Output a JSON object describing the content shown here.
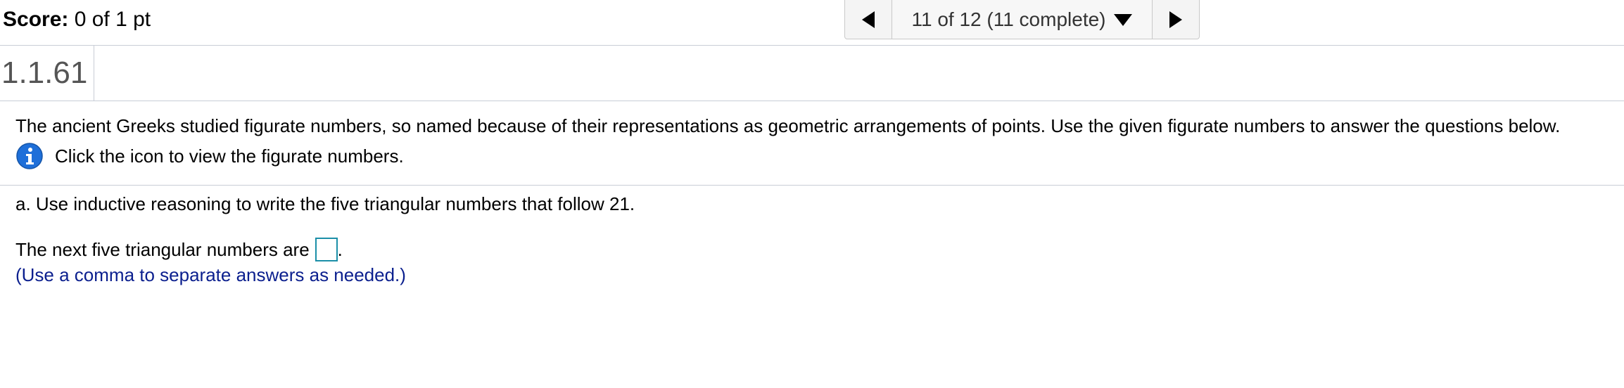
{
  "header": {
    "score_label": "Score:",
    "score_value": "0 of 1 pt",
    "nav": {
      "position_text": "11 of 12 (11 complete)"
    }
  },
  "question": {
    "id": "1.1.61",
    "intro": "The ancient Greeks studied figurate numbers, so named because of their representations as geometric arrangements of points.  Use the given figurate numbers to answer the questions below.",
    "info_text": "Click the icon to view the figurate numbers.",
    "part_a": "a. Use inductive reasoning to write the five triangular numbers that follow 21.",
    "answer_prefix": "The next five triangular numbers are",
    "answer_suffix": ".",
    "hint": "(Use a comma to separate answers as needed.)"
  },
  "colors": {
    "info_icon": "#1e6fd9",
    "hint": "#0b1f8e",
    "input_border": "#1b8fa8"
  },
  "icons": [
    "previous-arrow-icon",
    "dropdown-caret-icon",
    "next-arrow-icon",
    "info-icon"
  ]
}
